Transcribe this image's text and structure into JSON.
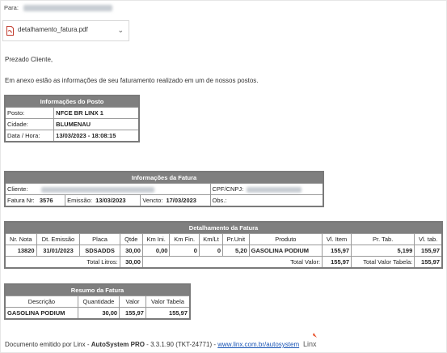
{
  "email": {
    "to_label": "Para:",
    "attachment": {
      "filename": "detalhamento_fatura.pdf",
      "icon": "pdf-file-icon",
      "menu_icon": "chevron-down-icon"
    },
    "greeting": "Prezado Cliente,",
    "intro": "Em anexo estão as informações de seu faturamento realizado em um de nossos postos."
  },
  "posto": {
    "title": "Informações do Posto",
    "rows": [
      {
        "label": "Posto:",
        "value": "NFCE BR LINX 1"
      },
      {
        "label": "Cidade:",
        "value": "BLUMENAU"
      },
      {
        "label": "Data / Hora:",
        "value": "13/03/2023 - 18:08:15"
      }
    ]
  },
  "fatura": {
    "title": "Informações da Fatura",
    "cliente_label": "Cliente:",
    "cpf_label": "CPF/CNPJ:",
    "fatura_nr_label": "Fatura Nr:",
    "fatura_nr": "3576",
    "emissao_label": "Emissão:",
    "emissao": "13/03/2023",
    "vencto_label": "Vencto:",
    "vencto": "17/03/2023",
    "obs_label": "Obs.:"
  },
  "detalhamento": {
    "title": "Detalhamento da Fatura",
    "headers": [
      "Nr. Nota",
      "Dt. Emissão",
      "Placa",
      "Qtde",
      "Km Ini.",
      "Km Fin.",
      "Km/Lt",
      "Pr.Unit",
      "Produto",
      "Vl. Item",
      "Pr. Tab.",
      "Vl. tab."
    ],
    "row": [
      "13820",
      "31/01/2023",
      "SDSADDS",
      "30,00",
      "0,00",
      "0",
      "0",
      "5,20",
      "GASOLINA PODIUM",
      "155,97",
      "5,199",
      "155,97"
    ],
    "total_litros_label": "Total Litros:",
    "total_litros": "30,00",
    "total_valor_label": "Total Valor:",
    "total_valor": "155,97",
    "total_tabela_label": "Total Valor Tabela:",
    "total_tabela": "155,97"
  },
  "resumo": {
    "title": "Resumo da Fatura",
    "headers": [
      "Descrição",
      "Quantidade",
      "Valor",
      "Valor Tabela"
    ],
    "row": [
      "GASOLINA PODIUM",
      "30,00",
      "155,97",
      "155,97"
    ]
  },
  "footer": {
    "prefix": "Documento emitido por Linx - ",
    "product": "AutoSystem PRO",
    "version": " - 3.3.1.90 (TKT-24771) - ",
    "link": "www.linx.com.br/autosystem",
    "logo_icon": "linx-logo-icon"
  }
}
